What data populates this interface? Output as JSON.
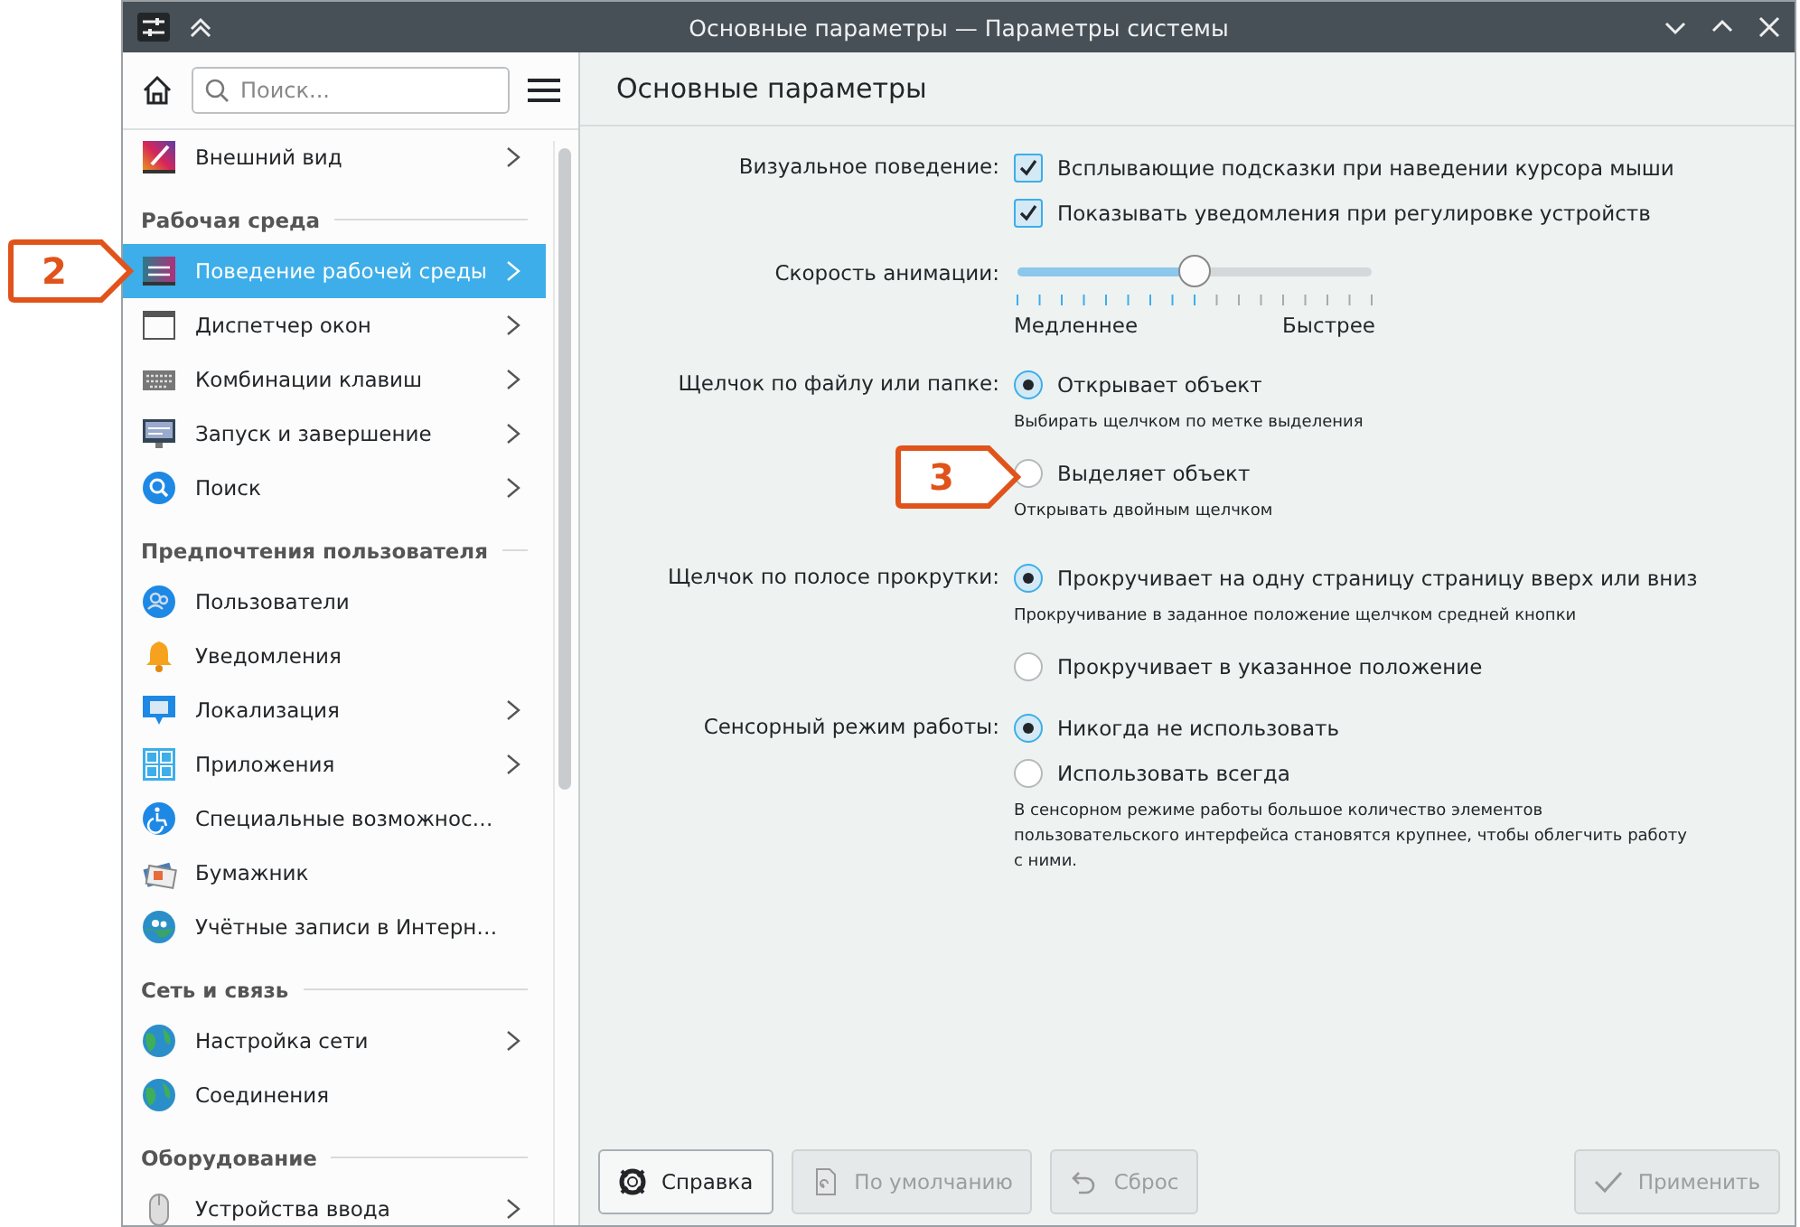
{
  "window": {
    "title": "Основные параметры — Параметры системы"
  },
  "sidebar": {
    "search": {
      "placeholder": "Поиск..."
    },
    "items": [
      {
        "kind": "item",
        "label": "Внешний вид",
        "selected": false,
        "expandable": true
      },
      {
        "kind": "group",
        "label": "Рабочая среда"
      },
      {
        "kind": "item",
        "label": "Поведение рабочей среды",
        "selected": true,
        "expandable": true,
        "callout": "2"
      },
      {
        "kind": "item",
        "label": "Диспетчер окон",
        "selected": false,
        "expandable": true
      },
      {
        "kind": "item",
        "label": "Комбинации клавиш",
        "selected": false,
        "expandable": true
      },
      {
        "kind": "item",
        "label": "Запуск и завершение",
        "selected": false,
        "expandable": true
      },
      {
        "kind": "item",
        "label": "Поиск",
        "selected": false,
        "expandable": true
      },
      {
        "kind": "group",
        "label": "Предпочтения пользователя"
      },
      {
        "kind": "item",
        "label": "Пользователи",
        "selected": false,
        "expandable": false
      },
      {
        "kind": "item",
        "label": "Уведомления",
        "selected": false,
        "expandable": false
      },
      {
        "kind": "item",
        "label": "Локализация",
        "selected": false,
        "expandable": true
      },
      {
        "kind": "item",
        "label": "Приложения",
        "selected": false,
        "expandable": true
      },
      {
        "kind": "item",
        "label": "Специальные возможнос…",
        "selected": false,
        "expandable": false
      },
      {
        "kind": "item",
        "label": "Бумажник",
        "selected": false,
        "expandable": false
      },
      {
        "kind": "item",
        "label": "Учётные записи в Интерн…",
        "selected": false,
        "expandable": false
      },
      {
        "kind": "group",
        "label": "Сеть и связь"
      },
      {
        "kind": "item",
        "label": "Настройка сети",
        "selected": false,
        "expandable": true
      },
      {
        "kind": "item",
        "label": "Соединения",
        "selected": false,
        "expandable": false
      },
      {
        "kind": "group",
        "label": "Оборудование"
      },
      {
        "kind": "item",
        "label": "Устройства ввода",
        "selected": false,
        "expandable": true
      }
    ]
  },
  "page": {
    "title": "Основные параметры",
    "settings": [
      {
        "label": "Визуальное поведение:",
        "controls": [
          {
            "kind": "checkbox",
            "label": "Всплывающие подсказки при наведении курсора мыши",
            "checked": true
          },
          {
            "kind": "checkbox",
            "label": "Показывать уведомления при регулировке устройств",
            "checked": true
          }
        ]
      },
      {
        "label": "Скорость анимации:",
        "controls": [
          {
            "kind": "slider",
            "level": 0.5,
            "min_label": "Медленнее",
            "max_label": "Быстрее"
          }
        ]
      },
      {
        "label": "Щелчок по файлу или папке:",
        "controls": [
          {
            "kind": "radio",
            "label": "Открывает объект",
            "selected": true
          },
          {
            "kind": "hint",
            "text": "Выбирать щелчком по метке выделения"
          },
          {
            "kind": "radio",
            "label": "Выделяет объект",
            "selected": false,
            "callout": "3"
          },
          {
            "kind": "hint",
            "text": "Открывать двойным щелчком"
          }
        ]
      },
      {
        "label": "Щелчок по полосе прокрутки:",
        "controls": [
          {
            "kind": "radio",
            "label": "Прокручивает на одну страницу страницу вверх или вниз",
            "selected": true
          },
          {
            "kind": "hint",
            "text": "Прокручивание в заданное положение щелчком средней кнопки"
          },
          {
            "kind": "radio",
            "label": "Прокручивает в указанное положение",
            "selected": false
          }
        ]
      },
      {
        "label": "Сенсорный режим работы:",
        "controls": [
          {
            "kind": "radio",
            "label": "Никогда не использовать",
            "selected": true
          },
          {
            "kind": "radio",
            "label": "Использовать всегда",
            "selected": false
          },
          {
            "kind": "hint",
            "text": "В сенсорном режиме работы большое количество элементов пользовательского интерфейса становятся крупнее, чтобы облегчить работу с ними."
          }
        ]
      }
    ]
  },
  "buttons": [
    {
      "label": "Справка",
      "disabled": false
    },
    {
      "label": "По умолчанию",
      "disabled": true
    },
    {
      "label": "Сброс",
      "disabled": true
    },
    {
      "label": "Применить",
      "disabled": true
    }
  ]
}
